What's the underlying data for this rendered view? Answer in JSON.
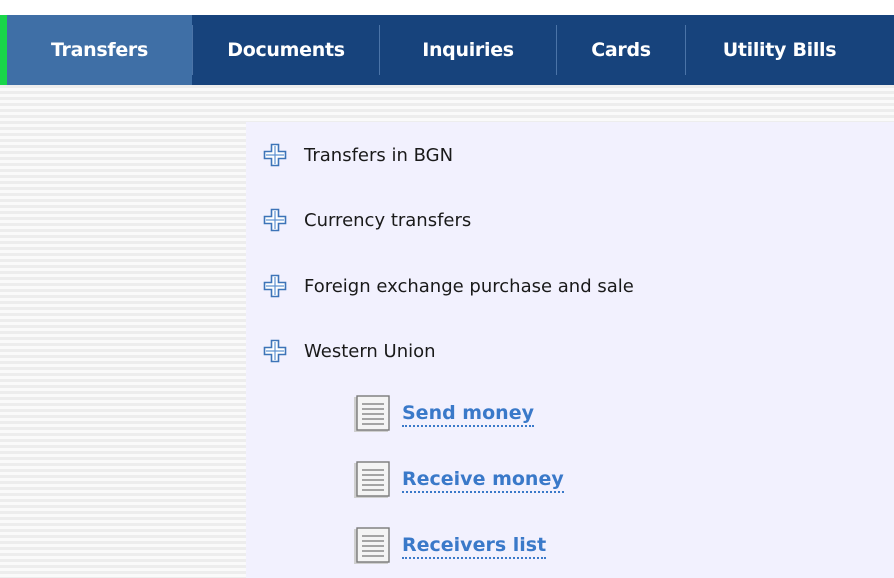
{
  "nav": {
    "tabs": [
      {
        "label": "Transfers",
        "active": true
      },
      {
        "label": "Documents",
        "active": false
      },
      {
        "label": "Inquiries",
        "active": false
      },
      {
        "label": "Cards",
        "active": false
      },
      {
        "label": "Utility Bills",
        "active": false
      }
    ]
  },
  "tree": {
    "items": [
      {
        "label": "Transfers in BGN",
        "icon": "plus-icon"
      },
      {
        "label": "Currency transfers",
        "icon": "plus-icon"
      },
      {
        "label": "Foreign exchange purchase and sale",
        "icon": "plus-icon"
      },
      {
        "label": "Western Union",
        "icon": "plus-icon"
      }
    ],
    "western_union_links": [
      {
        "label": "Send money",
        "icon": "document-icon"
      },
      {
        "label": "Receive money",
        "icon": "document-icon"
      },
      {
        "label": "Receivers list",
        "icon": "document-icon"
      }
    ]
  },
  "colors": {
    "nav_background": "#17437c",
    "active_tab": "#3f6fa6",
    "accent": "#19d64a",
    "link": "#3a79c9",
    "panel_background": "#f2f1fe"
  }
}
